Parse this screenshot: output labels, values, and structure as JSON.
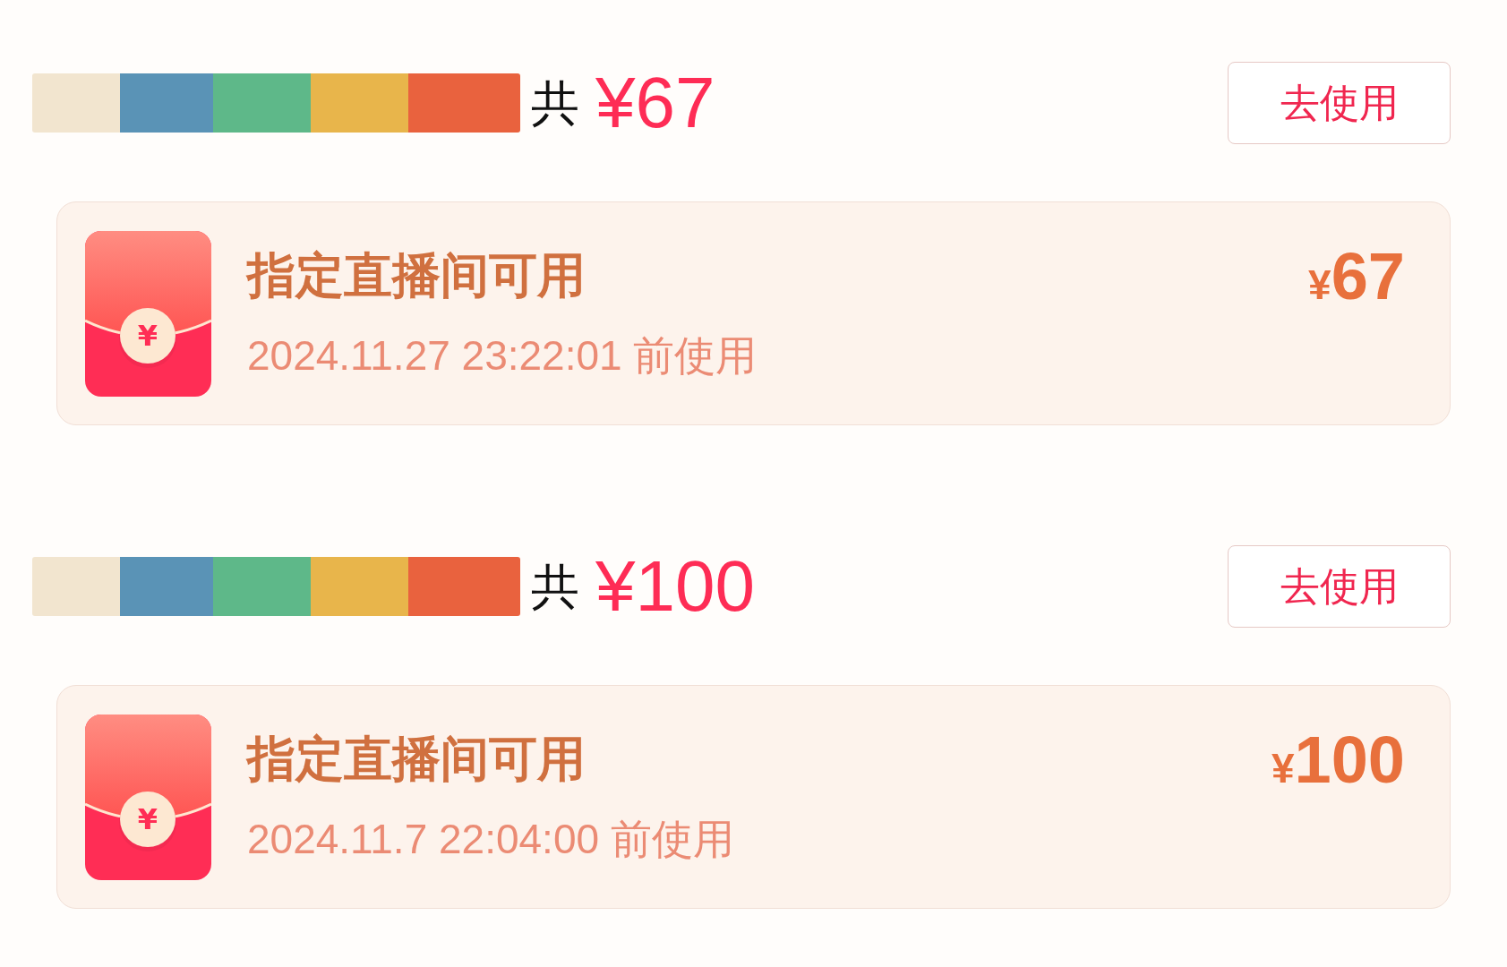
{
  "coupon_groups": [
    {
      "total_prefix": "共",
      "total": "¥67",
      "action": "去使用",
      "coupons": [
        {
          "icon_symbol": "¥",
          "title": "指定直播间可用",
          "expiry": "2024.11.27 23:22:01 前使用",
          "currency": "¥",
          "value": "67"
        }
      ]
    },
    {
      "total_prefix": "共",
      "total": "¥100",
      "action": "去使用",
      "coupons": [
        {
          "icon_symbol": "¥",
          "title": "指定直播间可用",
          "expiry": "2024.11.7 22:04:00 前使用",
          "currency": "¥",
          "value": "100"
        }
      ]
    }
  ]
}
